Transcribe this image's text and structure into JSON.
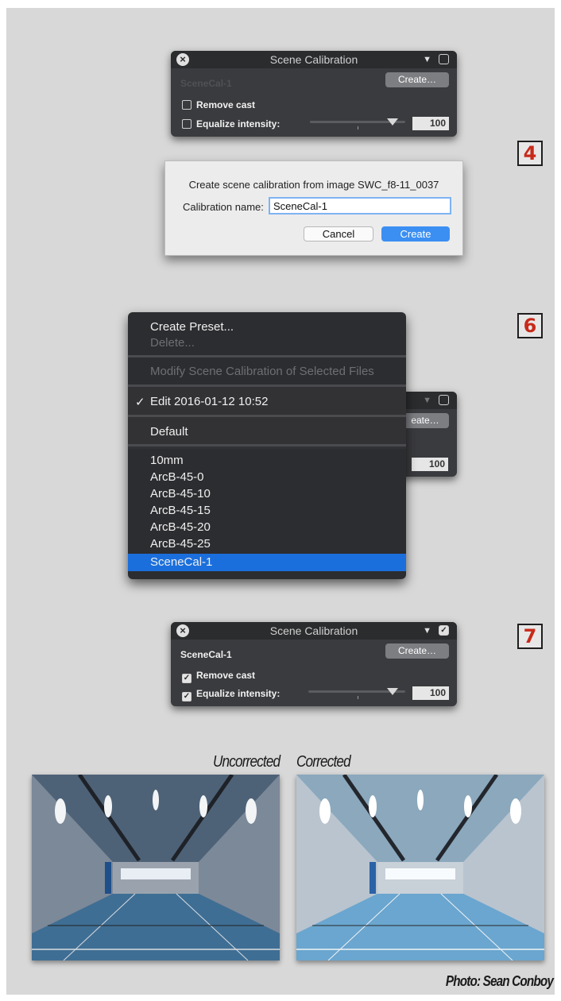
{
  "panel_top": {
    "title": "Scene Calibration",
    "preset_name": "SceneCal-1",
    "create_label": "Create…",
    "remove_cast_label": "Remove cast",
    "equalize_label": "Equalize intensity:",
    "intensity_value": "100",
    "remove_cast_checked": false,
    "equalize_checked": false,
    "enabled_checked": false
  },
  "dialog": {
    "message": "Create scene calibration from image SWC_f8-11_0037",
    "name_label": "Calibration name:",
    "name_value": "SceneCal-1",
    "cancel_label": "Cancel",
    "create_label": "Create"
  },
  "badges": {
    "step_4": "4",
    "step_6": "6",
    "step_7": "7"
  },
  "menu": {
    "create_preset": "Create Preset...",
    "delete": "Delete...",
    "modify": "Modify Scene Calibration of Selected Files",
    "edit_item": "Edit 2016-01-12 10:52",
    "check_mark": "✓",
    "default_item": "Default",
    "presets": [
      "10mm",
      "ArcB-45-0",
      "ArcB-45-10",
      "ArcB-45-15",
      "ArcB-45-20",
      "ArcB-45-25",
      "SceneCal-1"
    ],
    "selected_preset": "SceneCal-1"
  },
  "panel_behind": {
    "create_partial": "eate…",
    "intensity_value": "100"
  },
  "panel_bottom": {
    "title": "Scene Calibration",
    "preset_name": "SceneCal-1",
    "create_label": "Create…",
    "remove_cast_label": "Remove cast",
    "equalize_label": "Equalize intensity:",
    "intensity_value": "100",
    "remove_cast_checked": true,
    "equalize_checked": true,
    "enabled_checked": true
  },
  "photos": {
    "uncorrected_caption": "Uncorrected",
    "corrected_caption": "Corrected",
    "credit": "Photo: Sean Conboy"
  },
  "colors": {
    "panel_bg": "#3a3b3e",
    "menu_highlight": "#1b6fdc",
    "badge_digit": "#c82a1a",
    "uncorrected_floor": "#3f6e94",
    "corrected_floor": "#6aa6cf"
  }
}
